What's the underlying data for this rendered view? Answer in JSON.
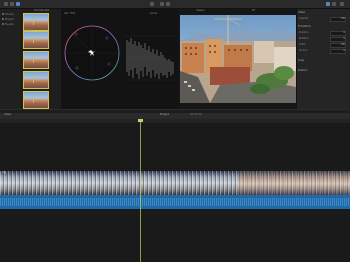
{
  "browser": {
    "header": "Thumbnails",
    "clips": [
      {
        "name": "clip 01"
      },
      {
        "name": "clip 02"
      },
      {
        "name": "clip 03"
      },
      {
        "name": "clip 04"
      },
      {
        "name": "clip 05"
      }
    ]
  },
  "sidebar": {
    "items": [
      {
        "label": "Library"
      },
      {
        "label": "Project"
      },
      {
        "label": "Events"
      }
    ]
  },
  "scopes": {
    "vectorscope_label": "Vec 75%",
    "waveform_label": "Luma"
  },
  "viewer": {
    "title": "Viewer",
    "zoom": "Fit"
  },
  "inspector": {
    "sections": [
      "Video",
      "Transform",
      "Crop",
      "Distort"
    ],
    "rows": [
      {
        "label": "Opacity",
        "value": "100"
      },
      {
        "label": "Position",
        "value": "0"
      },
      {
        "label": "Rotation",
        "value": "0"
      },
      {
        "label": "Scale",
        "value": "100"
      },
      {
        "label": "Anchor",
        "value": "0"
      }
    ]
  },
  "timeline": {
    "index_label": "Index",
    "project_title": "Project",
    "duration": "00:00:00",
    "clip_label": "clip"
  },
  "colors": {
    "accent": "#5a84c4",
    "selection": "#d6c24e",
    "playhead": "#c9cd6a",
    "audio": "#1f6aa8"
  }
}
